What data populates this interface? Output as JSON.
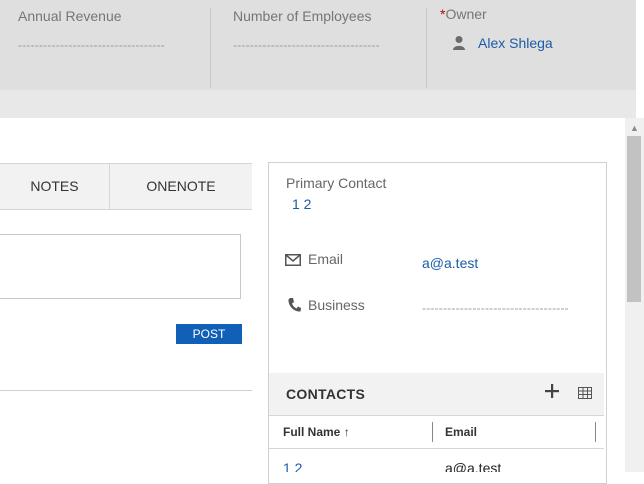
{
  "header": {
    "annual_revenue_label": "Annual Revenue",
    "annual_revenue_value": "-----------------------------------",
    "employees_label": "Number of Employees",
    "employees_value": "-----------------------------------",
    "owner_required_mark": "*",
    "owner_label": "Owner",
    "owner_value": "Alex Shlega"
  },
  "tabs": [
    {
      "label": "NOTES"
    },
    {
      "label": "ONENOTE"
    }
  ],
  "notes": {
    "post_label": "POST"
  },
  "summary": {
    "primary_contact_label": "Primary Contact",
    "primary_contact_value": "1 2",
    "email_label": "Email",
    "email_value": "a@a.test",
    "business_label": "Business",
    "business_value": "-----------------------------------"
  },
  "contacts": {
    "title": "CONTACTS",
    "add_icon": "plus-icon",
    "view_icon": "grid-icon",
    "columns": [
      {
        "label": "Full Name",
        "sort": "ascending"
      },
      {
        "label": "Email"
      }
    ],
    "rows": [
      {
        "full_name": "1 2",
        "email": "a@a.test"
      }
    ]
  },
  "colors": {
    "link": "#1b5ba6",
    "post_button": "#1160b7",
    "required": "#c00000",
    "header_bg": "#dfdfdf"
  }
}
